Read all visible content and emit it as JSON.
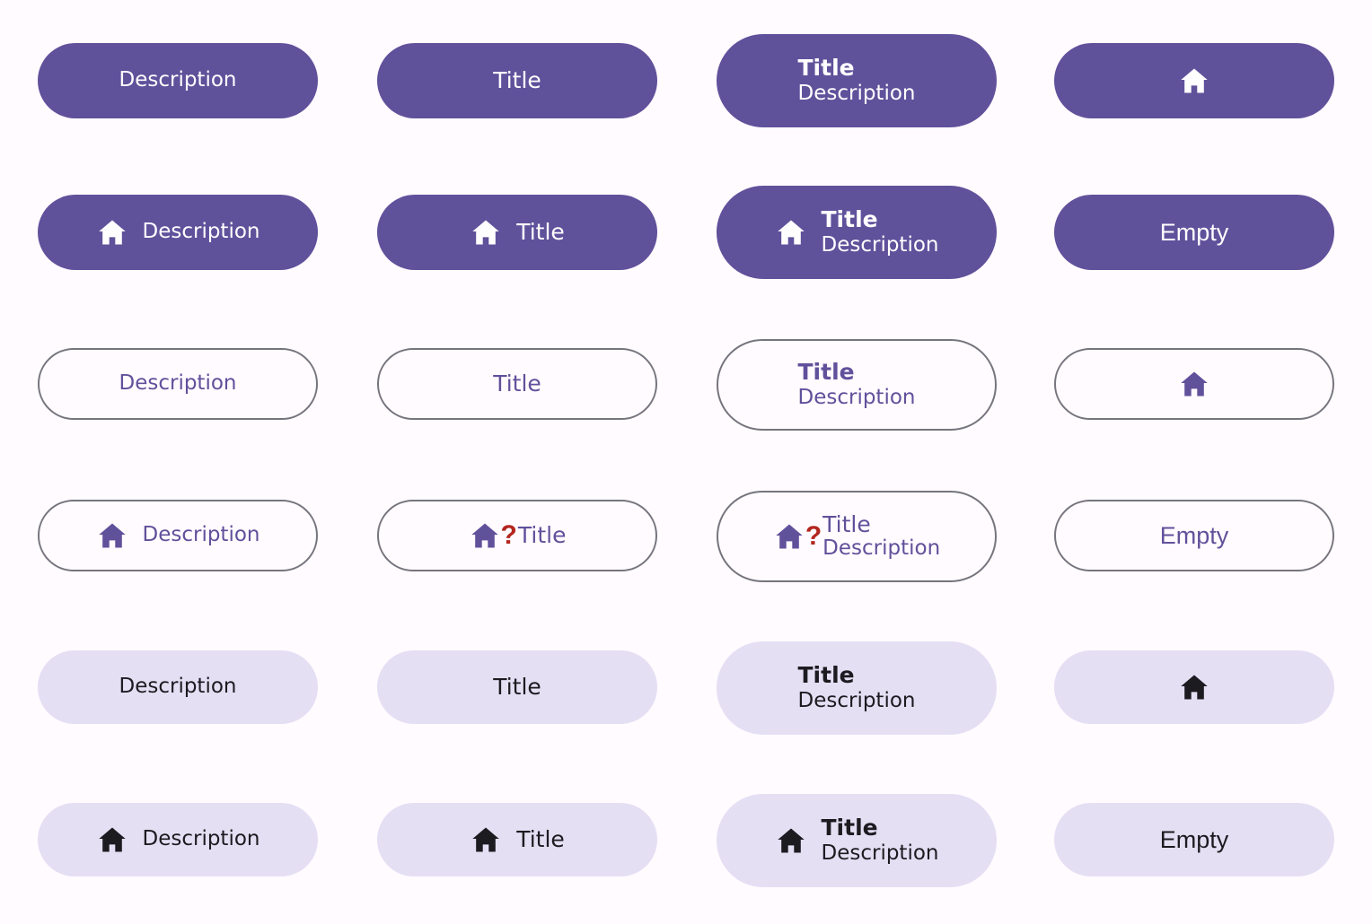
{
  "page": {
    "background": "#fffbff",
    "colors": {
      "filled_bg": "#60519b",
      "filled_fg": "#ffffff",
      "outlined_border": "#76757e",
      "outlined_fg": "#60519b",
      "tonal_bg": "#e5dff4",
      "tonal_fg": "#1c1b20",
      "error_glyph": "#b3261e"
    }
  },
  "labels": {
    "title": "Title",
    "description": "Description",
    "empty": "Empty",
    "missing_glyph": "?"
  },
  "icons": {
    "home": "home-icon"
  },
  "rows": [
    {
      "variant": "filled",
      "has_icon": false,
      "buttons": [
        {
          "kind": "description",
          "description": "Description"
        },
        {
          "kind": "title",
          "title": "Title"
        },
        {
          "kind": "title-description",
          "title": "Title",
          "description": "Description"
        },
        {
          "kind": "icon-only",
          "icon": "home-icon"
        }
      ]
    },
    {
      "variant": "filled",
      "has_icon": true,
      "buttons": [
        {
          "kind": "icon-description",
          "icon": "home-icon",
          "description": "Description"
        },
        {
          "kind": "icon-title",
          "icon": "home-icon",
          "title": "Title"
        },
        {
          "kind": "icon-title-description",
          "icon": "home-icon",
          "title": "Title",
          "description": "Description"
        },
        {
          "kind": "empty",
          "empty": "Empty"
        }
      ]
    },
    {
      "variant": "outlined",
      "has_icon": false,
      "buttons": [
        {
          "kind": "description",
          "description": "Description"
        },
        {
          "kind": "title",
          "title": "Title"
        },
        {
          "kind": "title-description",
          "title": "Title",
          "description": "Description"
        },
        {
          "kind": "icon-only",
          "icon": "home-icon"
        }
      ]
    },
    {
      "variant": "outlined",
      "has_icon": true,
      "buttons": [
        {
          "kind": "icon-description",
          "icon": "home-icon",
          "description": "Description"
        },
        {
          "kind": "icon-tofu-title",
          "icon": "home-icon",
          "missing_glyph": "?",
          "title": "Title"
        },
        {
          "kind": "icon-tofu-title-description",
          "icon": "home-icon",
          "missing_glyph": "?",
          "title": "Title",
          "description": "Description"
        },
        {
          "kind": "empty",
          "empty": "Empty"
        }
      ]
    },
    {
      "variant": "tonal",
      "has_icon": false,
      "buttons": [
        {
          "kind": "description",
          "description": "Description"
        },
        {
          "kind": "title",
          "title": "Title"
        },
        {
          "kind": "title-description",
          "title": "Title",
          "description": "Description"
        },
        {
          "kind": "icon-only",
          "icon": "home-icon"
        }
      ]
    },
    {
      "variant": "tonal",
      "has_icon": true,
      "buttons": [
        {
          "kind": "icon-description",
          "icon": "home-icon",
          "description": "Description"
        },
        {
          "kind": "icon-title",
          "icon": "home-icon",
          "title": "Title"
        },
        {
          "kind": "icon-title-description",
          "icon": "home-icon",
          "title": "Title",
          "description": "Description"
        },
        {
          "kind": "empty",
          "empty": "Empty"
        }
      ]
    }
  ]
}
